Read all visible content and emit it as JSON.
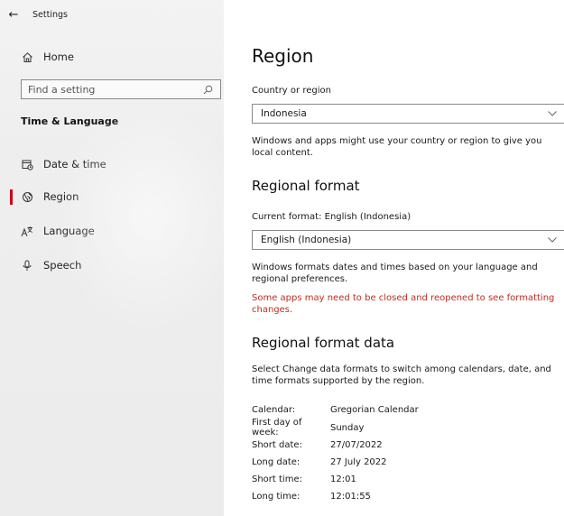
{
  "window": {
    "title": "Settings"
  },
  "sidebar": {
    "home_label": "Home",
    "search_placeholder": "Find a setting",
    "section_title": "Time & Language",
    "items": [
      {
        "label": "Date & time",
        "icon": "calendar-clock-icon",
        "selected": false
      },
      {
        "label": "Region",
        "icon": "globe-icon",
        "selected": true
      },
      {
        "label": "Language",
        "icon": "language-icon",
        "selected": false
      },
      {
        "label": "Speech",
        "icon": "microphone-icon",
        "selected": false
      }
    ],
    "accent_color": "#d00018"
  },
  "main": {
    "title": "Region",
    "country": {
      "label": "Country or region",
      "value": "Indonesia",
      "description": "Windows and apps might use your country or region to give you local content."
    },
    "regional_format": {
      "heading": "Regional format",
      "current_label": "Current format: English (Indonesia)",
      "value": "English (Indonesia)",
      "description": "Windows formats dates and times based on your language and regional preferences.",
      "warning": "Some apps may need to be closed and reopened to see formatting changes.",
      "warning_color": "#c42b1c"
    },
    "format_data": {
      "heading": "Regional format data",
      "description": "Select Change data formats to switch among calendars, date, and time formats supported by the region.",
      "rows": [
        {
          "key": "Calendar:",
          "value": "Gregorian Calendar"
        },
        {
          "key": "First day of week:",
          "value": "Sunday"
        },
        {
          "key": "Short date:",
          "value": "27/07/2022"
        },
        {
          "key": "Long date:",
          "value": "27 July 2022"
        },
        {
          "key": "Short time:",
          "value": "12:01"
        },
        {
          "key": "Long time:",
          "value": "12:01:55"
        }
      ]
    }
  }
}
